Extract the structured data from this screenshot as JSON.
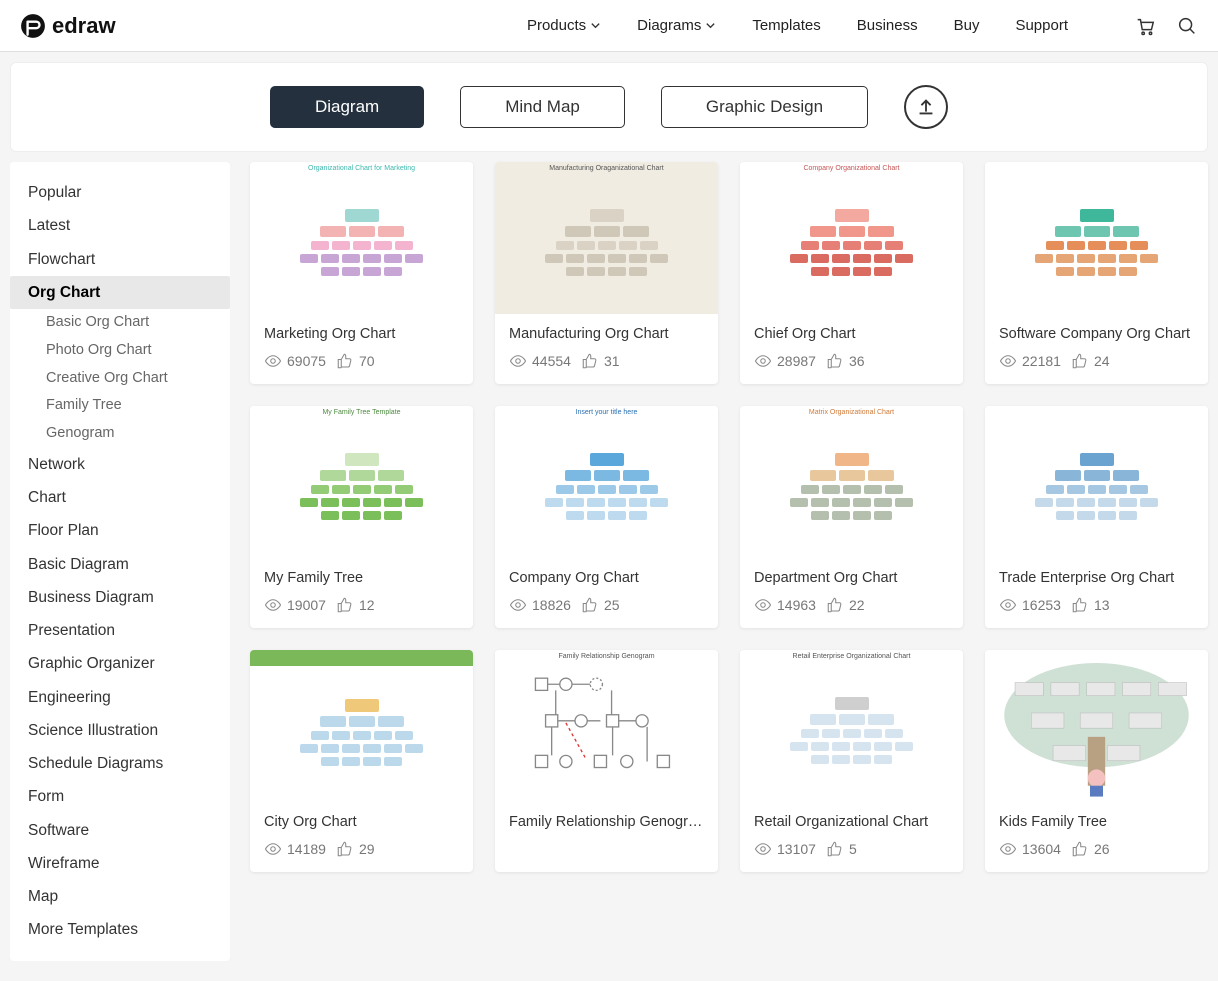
{
  "brand": "edraw",
  "nav": {
    "products": "Products",
    "diagrams": "Diagrams",
    "templates": "Templates",
    "business": "Business",
    "buy": "Buy",
    "support": "Support"
  },
  "tabs": {
    "diagram": "Diagram",
    "mindmap": "Mind Map",
    "graphic": "Graphic Design"
  },
  "sidebar": {
    "popular": "Popular",
    "latest": "Latest",
    "flowchart": "Flowchart",
    "orgchart": "Org Chart",
    "sub": {
      "basic": "Basic Org Chart",
      "photo": "Photo Org Chart",
      "creative": "Creative Org Chart",
      "family": "Family Tree",
      "genogram": "Genogram"
    },
    "network": "Network",
    "chart": "Chart",
    "floorplan": "Floor Plan",
    "basicdiag": "Basic Diagram",
    "busdiag": "Business Diagram",
    "presentation": "Presentation",
    "graphorg": "Graphic Organizer",
    "engineering": "Engineering",
    "science": "Science Illustration",
    "schedule": "Schedule Diagrams",
    "form": "Form",
    "software": "Software",
    "wireframe": "Wireframe",
    "map": "Map",
    "more": "More Templates"
  },
  "templates": [
    {
      "title": "Marketing Org Chart",
      "views": "69075",
      "likes": "70",
      "thumb_label": "Organizational Chart for Marketing"
    },
    {
      "title": "Manufacturing Org Chart",
      "views": "44554",
      "likes": "31",
      "thumb_label": "Manufacturing Oraganizational Chart"
    },
    {
      "title": "Chief Org Chart",
      "views": "28987",
      "likes": "36",
      "thumb_label": "Company Organizational Chart"
    },
    {
      "title": "Software Company Org Chart",
      "views": "22181",
      "likes": "24",
      "thumb_label": ""
    },
    {
      "title": "My Family Tree",
      "views": "19007",
      "likes": "12",
      "thumb_label": "My Family Tree Template"
    },
    {
      "title": "Company Org Chart",
      "views": "18826",
      "likes": "25",
      "thumb_label": "Insert your title here"
    },
    {
      "title": "Department Org Chart",
      "views": "14963",
      "likes": "22",
      "thumb_label": "Matrix Organizational Chart"
    },
    {
      "title": "Trade Enterprise Org Chart",
      "views": "16253",
      "likes": "13",
      "thumb_label": ""
    },
    {
      "title": "City Org Chart",
      "views": "14189",
      "likes": "29",
      "thumb_label": ""
    },
    {
      "title": "Family Relationship Genogram",
      "views": "",
      "likes": "",
      "thumb_label": "Family Relationship Genogram"
    },
    {
      "title": "Retail Organizational Chart",
      "views": "13107",
      "likes": "5",
      "thumb_label": "Retail Enterprise Organizational Chart"
    },
    {
      "title": "Kids Family Tree",
      "views": "13604",
      "likes": "26",
      "thumb_label": ""
    }
  ],
  "thumb_styles": [
    {
      "bg": "#ffffff",
      "title_color": "#3fb8af",
      "colors": [
        "#9fd7d3",
        "#f4b3b3",
        "#f4b3cf",
        "#c7a6d6"
      ]
    },
    {
      "bg": "#f1ece2",
      "title_color": "#555",
      "colors": [
        "#d9d2c5",
        "#cfc7b7",
        "#d9d2c5",
        "#cfc7b7"
      ]
    },
    {
      "bg": "#ffffff",
      "title_color": "#c65757",
      "colors": [
        "#f3a8a0",
        "#f0968b",
        "#e68076",
        "#d96b60"
      ]
    },
    {
      "bg": "#ffffff",
      "title_color": "#2b8a74",
      "colors": [
        "#3eb79a",
        "#6fc6b0",
        "#e58e5a",
        "#e5a575"
      ]
    },
    {
      "bg": "#ffffff",
      "title_color": "#4d8a3f",
      "colors": [
        "#cfe6bf",
        "#b0d89a",
        "#93cb77",
        "#7abf5a"
      ]
    },
    {
      "bg": "#ffffff",
      "title_color": "#2a6fb0",
      "colors": [
        "#5aa7dc",
        "#7bb8e2",
        "#9cc9e8",
        "#bddaee"
      ]
    },
    {
      "bg": "#ffffff",
      "title_color": "#d07a3a",
      "colors": [
        "#f0b688",
        "#e8c79c",
        "#b4bfae",
        "#b4bfae"
      ]
    },
    {
      "bg": "#ffffff",
      "title_color": "#2a6fb0",
      "colors": [
        "#6aa3cf",
        "#88b5d8",
        "#a6c7e1",
        "#c4d9ea"
      ]
    },
    {
      "bg": "#ffffff",
      "title_color": "#5a9a3e",
      "colors": [
        "#f0c879",
        "#bcd9ec",
        "#bcd9ec",
        "#bcd9ec"
      ],
      "header": "#7bb85a"
    },
    {
      "bg": "#ffffff",
      "title_color": "#555",
      "genogram": true
    },
    {
      "bg": "#ffffff",
      "title_color": "#555",
      "colors": [
        "#cfcfcf",
        "#d6e4f0",
        "#d6e4f0",
        "#d6e4f0"
      ]
    },
    {
      "bg": "#ffffff",
      "title_color": "#6aa884",
      "colors": [
        "#d8e8de",
        "#c5ddcf",
        "#b2d2c0",
        "#9fc7b1"
      ],
      "tree": true
    }
  ]
}
